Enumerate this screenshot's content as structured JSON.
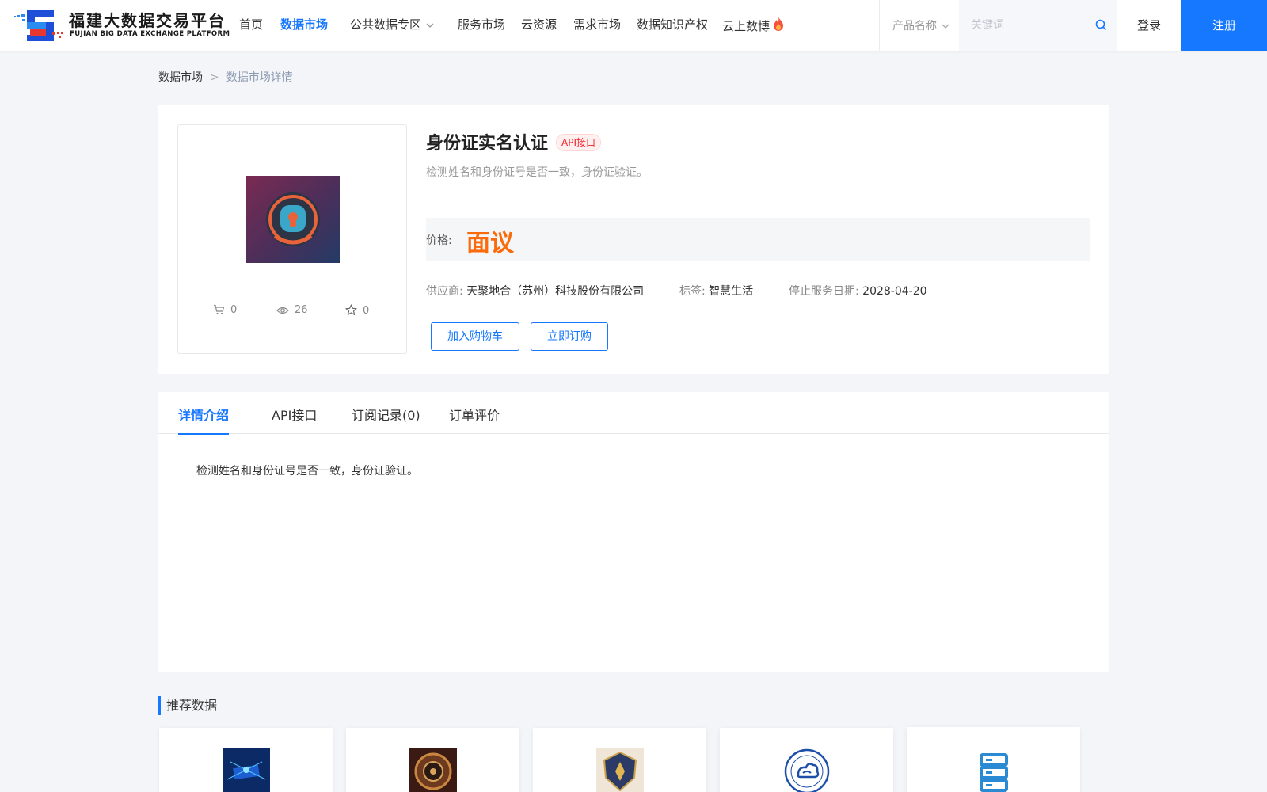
{
  "header": {
    "logo_cn": "福建大数据交易平台",
    "logo_en": "FUJIAN BIG DATA EXCHANGE  PLATFORM",
    "nav": [
      {
        "label": "首页"
      },
      {
        "label": "数据市场",
        "active": true
      },
      {
        "label": "公共数据专区",
        "has_dropdown": true
      },
      {
        "label": "服务市场"
      },
      {
        "label": "云资源"
      },
      {
        "label": "需求市场"
      },
      {
        "label": "数据知识产权"
      },
      {
        "label": "云上数博",
        "icon": "flame-icon"
      }
    ],
    "search": {
      "select_label": "产品名称",
      "placeholder": "关键词",
      "value": ""
    },
    "login": "登录",
    "register": "注册"
  },
  "breadcrumb": {
    "parent": "数据市场",
    "separator": ">",
    "current": "数据市场详情"
  },
  "product": {
    "title": "身份证实名认证",
    "badge": "API接口",
    "description": "检测姓名和身份证号是否一致，身份证验证。",
    "price_label": "价格:",
    "price_value": "面议",
    "stats": {
      "cart": "0",
      "views": "26",
      "favorites": "0"
    },
    "supplier_label": "供应商:",
    "supplier": "天聚地合（苏州）科技股份有限公司",
    "tag_label": "标签:",
    "tag": "智慧生活",
    "end_date_label": "停止服务日期:",
    "end_date": "2028-04-20",
    "add_cart": "加入购物车",
    "buy_now": "立即订购"
  },
  "tabs": [
    {
      "label": "详情介绍",
      "active": true
    },
    {
      "label": "API接口"
    },
    {
      "label": "订阅记录(0)"
    },
    {
      "label": "订单评价"
    }
  ],
  "detail_text": "检测姓名和身份证号是否一致，身份证验证。",
  "recommend": {
    "title": "推荐数据"
  },
  "colors": {
    "primary": "#1677ff",
    "price": "#fa6b0b",
    "badge": "#f5222d",
    "page_bg": "#f3f5f8"
  }
}
